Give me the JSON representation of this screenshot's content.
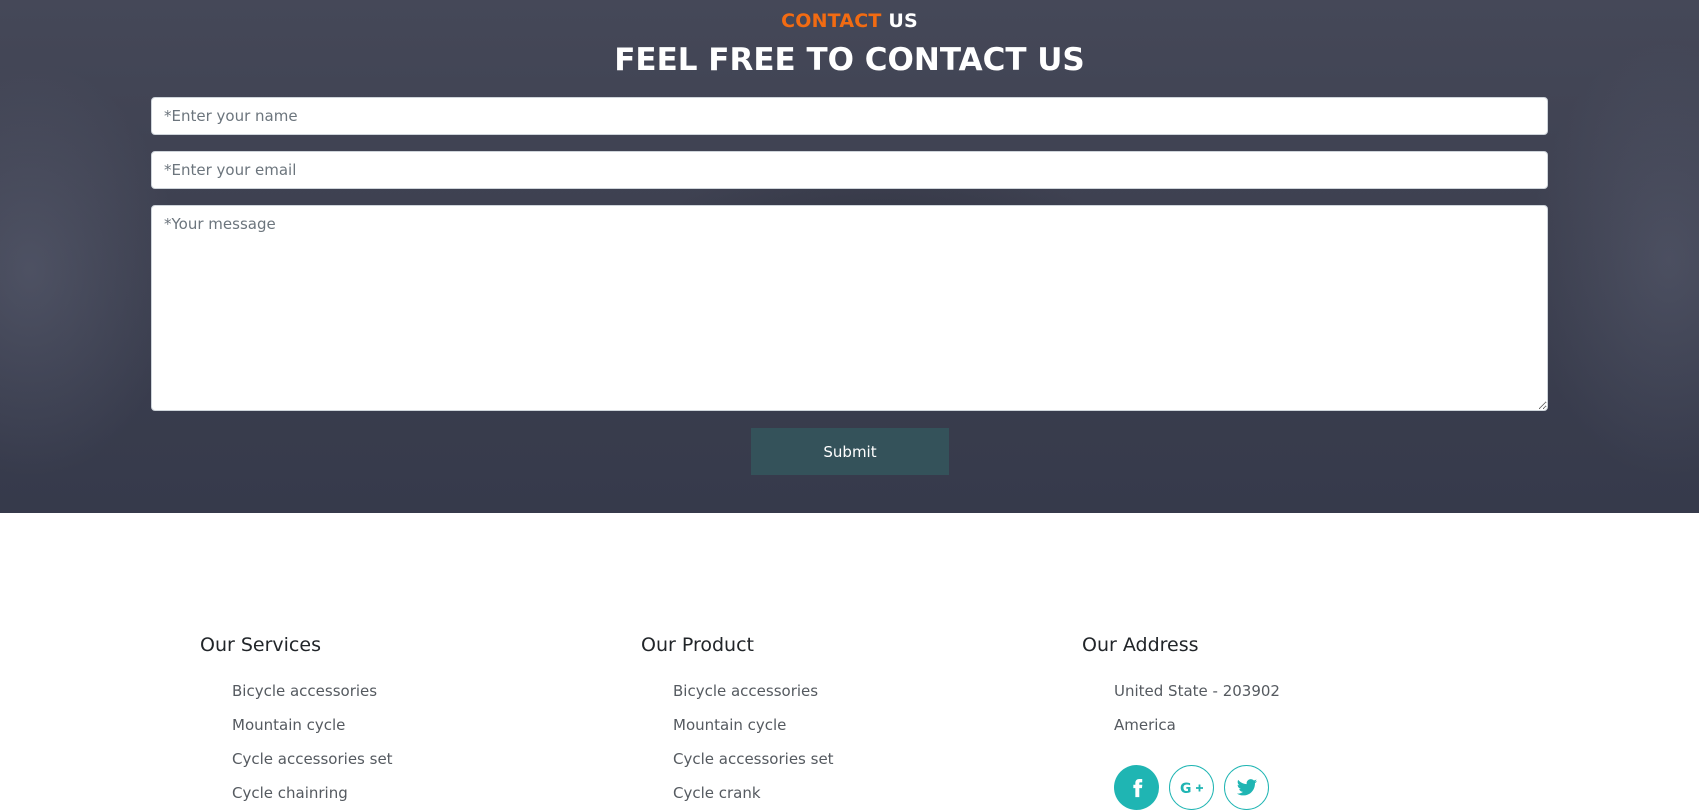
{
  "contact": {
    "sub_title_accent": "CONTACT",
    "sub_title_rest": "US",
    "title": "FEEL FREE TO CONTACT US",
    "name_placeholder": "*Enter your name",
    "email_placeholder": "*Enter your email",
    "message_placeholder": "*Your message",
    "submit_label": "Submit"
  },
  "footer": {
    "services": {
      "heading": "Our Services",
      "items": [
        "Bicycle accessories",
        "Mountain cycle",
        "Cycle accessories set",
        "Cycle chainring"
      ]
    },
    "product": {
      "heading": "Our Product",
      "items": [
        "Bicycle accessories",
        "Mountain cycle",
        "Cycle accessories set",
        "Cycle crank"
      ]
    },
    "address": {
      "heading": "Our Address",
      "lines": [
        "United State - 203902",
        "America"
      ]
    },
    "social_icons": [
      "facebook-icon",
      "google-plus-icon",
      "twitter-icon"
    ]
  },
  "colors": {
    "accent_orange": "#f26b12",
    "submit_bg": "#34525a",
    "social_teal": "#1fb5b3",
    "contact_bg": "#3d4050"
  }
}
